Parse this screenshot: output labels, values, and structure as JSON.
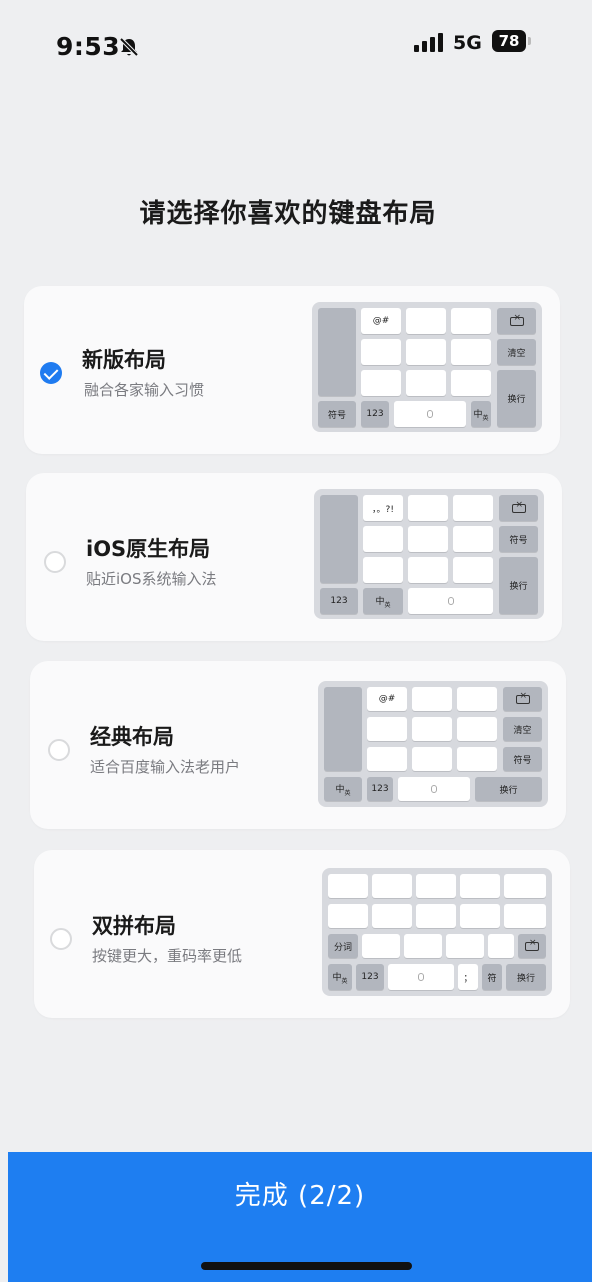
{
  "status_bar": {
    "time": "9:53",
    "network": "5G",
    "battery": "78"
  },
  "page_title": "请选择你喜欢的键盘布局",
  "options": [
    {
      "title": "新版布局",
      "subtitle": "融合各家输入习惯",
      "selected": true,
      "keys": {
        "top_symbols": "@#",
        "clear": "清空",
        "enter": "换行",
        "symbols": "符号",
        "num": "123",
        "zh": "中",
        "zh_sub": "英"
      }
    },
    {
      "title": "iOS原生布局",
      "subtitle": "贴近iOS系统输入法",
      "selected": false,
      "keys": {
        "top_symbols": "，。?!",
        "symbols": "符号",
        "enter": "换行",
        "num": "123",
        "zh": "中",
        "zh_sub": "英"
      }
    },
    {
      "title": "经典布局",
      "subtitle": "适合百度输入法老用户",
      "selected": false,
      "keys": {
        "top_symbols": "@#",
        "clear": "清空",
        "symbols": "符号",
        "enter": "换行",
        "num": "123",
        "zh": "中",
        "zh_sub": "英"
      }
    },
    {
      "title": "双拼布局",
      "subtitle": "按键更大，重码率更低",
      "selected": false,
      "keys": {
        "split": "分词",
        "num": "123",
        "semicolon": "；",
        "symbol": "符",
        "enter": "换行",
        "zh": "中",
        "zh_sub": "英"
      }
    }
  ],
  "done_button": "完成 (2/2)",
  "icons": {
    "bell": "bell-slash-icon",
    "signal": "signal-bars-icon",
    "battery": "battery-icon",
    "check": "check-icon",
    "delete": "backspace-icon",
    "mic": "microphone-icon"
  },
  "colors": {
    "accent": "#1e7ef1",
    "background": "#eeeff1",
    "card": "#fafafb"
  }
}
